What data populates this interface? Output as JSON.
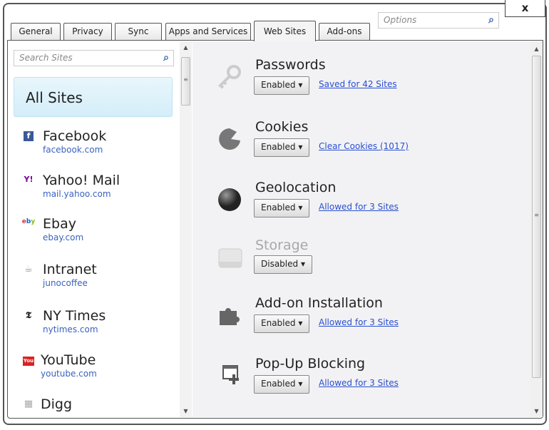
{
  "window": {
    "close_label": "x",
    "options_placeholder": "Options"
  },
  "tabs": [
    {
      "label": "General"
    },
    {
      "label": "Privacy"
    },
    {
      "label": "Sync"
    },
    {
      "label": "Apps and Services"
    },
    {
      "label": "Web Sites",
      "active": true
    },
    {
      "label": "Add-ons"
    }
  ],
  "sidebar": {
    "search_placeholder": "Search Sites",
    "all_sites": "All Sites",
    "sites": [
      {
        "name": "Facebook",
        "url": "facebook.com",
        "icon": "facebook-icon"
      },
      {
        "name": "Yahoo! Mail",
        "url": "mail.yahoo.com",
        "icon": "yahoo-icon"
      },
      {
        "name": "Ebay",
        "url": "ebay.com",
        "icon": "ebay-icon"
      },
      {
        "name": "Intranet",
        "url": "junocoffee",
        "icon": "coffee-cup-icon"
      },
      {
        "name": "NY Times",
        "url": "nytimes.com",
        "icon": "nytimes-icon"
      },
      {
        "name": "YouTube",
        "url": "youtube.com",
        "icon": "youtube-icon"
      },
      {
        "name": "Digg",
        "url": "",
        "icon": "digg-icon"
      }
    ]
  },
  "settings": [
    {
      "title": "Passwords",
      "value": "Enabled",
      "link": "Saved for 42 Sites",
      "icon": "key-icon"
    },
    {
      "title": "Cookies",
      "value": "Enabled",
      "link": "Clear Cookies (1017)",
      "icon": "cookie-icon"
    },
    {
      "title": "Geolocation",
      "value": "Enabled",
      "link": "Allowed for 3 Sites",
      "icon": "globe-icon"
    },
    {
      "title": "Storage",
      "value": "Disabled",
      "link": "",
      "icon": "hard-drive-icon",
      "dimmed": true
    },
    {
      "title": "Add-on Installation",
      "value": "Enabled",
      "link": "Allowed for 3 Sites",
      "icon": "puzzle-piece-icon"
    },
    {
      "title": "Pop-Up Blocking",
      "value": "Enabled",
      "link": "Allowed for 3 Sites",
      "icon": "popup-window-icon"
    }
  ],
  "colors": {
    "link": "#2a4fcf",
    "selected_bg": "#d4eef9"
  }
}
